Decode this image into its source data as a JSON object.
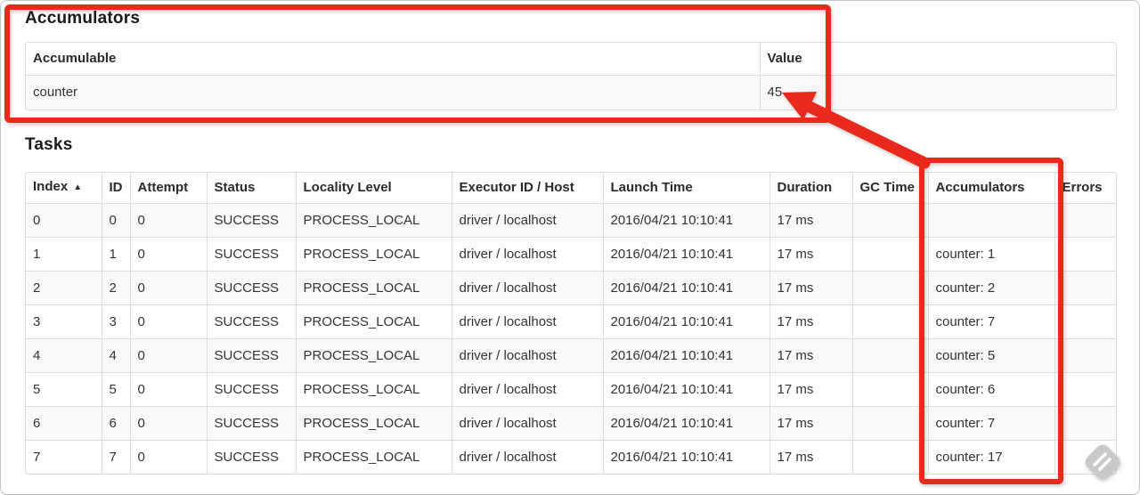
{
  "accumulators": {
    "title": "Accumulators",
    "table": {
      "headers": [
        "Accumulable",
        "Value"
      ],
      "rows": [
        [
          "counter",
          "45"
        ]
      ]
    }
  },
  "tasks": {
    "title": "Tasks",
    "table": {
      "headers": [
        "Index",
        "ID",
        "Attempt",
        "Status",
        "Locality Level",
        "Executor ID / Host",
        "Launch Time",
        "Duration",
        "GC Time",
        "Accumulators",
        "Errors"
      ],
      "sort": {
        "column": 0,
        "glyph": "▲",
        "direction": "ascending"
      },
      "rows": [
        [
          "0",
          "0",
          "0",
          "SUCCESS",
          "PROCESS_LOCAL",
          "driver / localhost",
          "2016/04/21 10:10:41",
          "17 ms",
          "",
          "",
          ""
        ],
        [
          "1",
          "1",
          "0",
          "SUCCESS",
          "PROCESS_LOCAL",
          "driver / localhost",
          "2016/04/21 10:10:41",
          "17 ms",
          "",
          "counter: 1",
          ""
        ],
        [
          "2",
          "2",
          "0",
          "SUCCESS",
          "PROCESS_LOCAL",
          "driver / localhost",
          "2016/04/21 10:10:41",
          "17 ms",
          "",
          "counter: 2",
          ""
        ],
        [
          "3",
          "3",
          "0",
          "SUCCESS",
          "PROCESS_LOCAL",
          "driver / localhost",
          "2016/04/21 10:10:41",
          "17 ms",
          "",
          "counter: 7",
          ""
        ],
        [
          "4",
          "4",
          "0",
          "SUCCESS",
          "PROCESS_LOCAL",
          "driver / localhost",
          "2016/04/21 10:10:41",
          "17 ms",
          "",
          "counter: 5",
          ""
        ],
        [
          "5",
          "5",
          "0",
          "SUCCESS",
          "PROCESS_LOCAL",
          "driver / localhost",
          "2016/04/21 10:10:41",
          "17 ms",
          "",
          "counter: 6",
          ""
        ],
        [
          "6",
          "6",
          "0",
          "SUCCESS",
          "PROCESS_LOCAL",
          "driver / localhost",
          "2016/04/21 10:10:41",
          "17 ms",
          "",
          "counter: 7",
          ""
        ],
        [
          "7",
          "7",
          "0",
          "SUCCESS",
          "PROCESS_LOCAL",
          "driver / localhost",
          "2016/04/21 10:10:41",
          "17 ms",
          "",
          "counter: 17",
          ""
        ]
      ]
    }
  },
  "annotations": {
    "color": "#e8291c",
    "watermark_color": "#c9c9c9",
    "box1_target": "accumulators-summary-table",
    "box2_target": "accumulators-column",
    "arrow_target": "value-45"
  }
}
